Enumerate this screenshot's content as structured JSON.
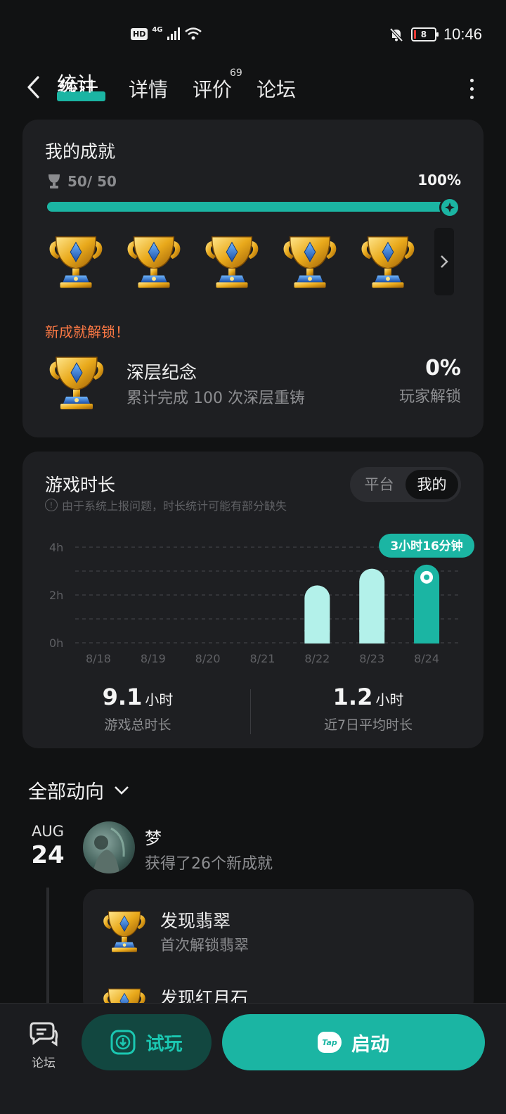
{
  "status": {
    "hd": "HD",
    "network": "4G",
    "battery": "8",
    "time": "10:46"
  },
  "nav": {
    "tabs": [
      {
        "label": "统计"
      },
      {
        "label": "详情"
      },
      {
        "label": "评价"
      },
      {
        "label": "论坛"
      }
    ],
    "review_count": "69"
  },
  "achievements": {
    "title": "我的成就",
    "count": "50/ 50",
    "percent_label": "100%",
    "progress": 1.0,
    "new_unlock": "新成就解锁！",
    "latest": {
      "name": "深层纪念",
      "desc": "累计完成 100 次深层重铸",
      "pct": "0%",
      "pct_label": "玩家解锁"
    }
  },
  "playtime": {
    "title": "游戏时长",
    "note": "由于系统上报问题，时长统计可能有部分缺失",
    "toggle": [
      "平台",
      "我的"
    ],
    "total_value": "9.1",
    "total_unit": "小时",
    "total_label": "游戏总时长",
    "avg_value": "1.2",
    "avg_unit": "小时",
    "avg_label": "近7日平均时长",
    "tooltip": "3小时16分钟"
  },
  "chart_data": {
    "type": "bar",
    "categories": [
      "8/18",
      "8/19",
      "8/20",
      "8/21",
      "8/22",
      "8/23",
      "8/24"
    ],
    "values": [
      0,
      0,
      0,
      0,
      2.4,
      3.1,
      3.27
    ],
    "ylim": [
      0,
      4
    ],
    "yticks": [
      "0h",
      "2h",
      "4h"
    ],
    "highlight_index": 6,
    "colors": {
      "normal": "#b3f1ea",
      "highlight": "#1bb5a3"
    }
  },
  "activity": {
    "header": "全部动向",
    "month": "AUG",
    "day": "24",
    "user": "梦",
    "action": "获得了26个新成就",
    "items": [
      {
        "title": "发现翡翠",
        "desc": "首次解锁翡翠"
      },
      {
        "title": "发现红月石",
        "desc": ""
      }
    ]
  },
  "bottom": {
    "forum": "论坛",
    "trial": "试玩",
    "launch": "启动",
    "tap": "Tap"
  },
  "colors": {
    "accent": "#1bb5a3",
    "orange": "#ff7a45",
    "card": "#1e1f22"
  }
}
